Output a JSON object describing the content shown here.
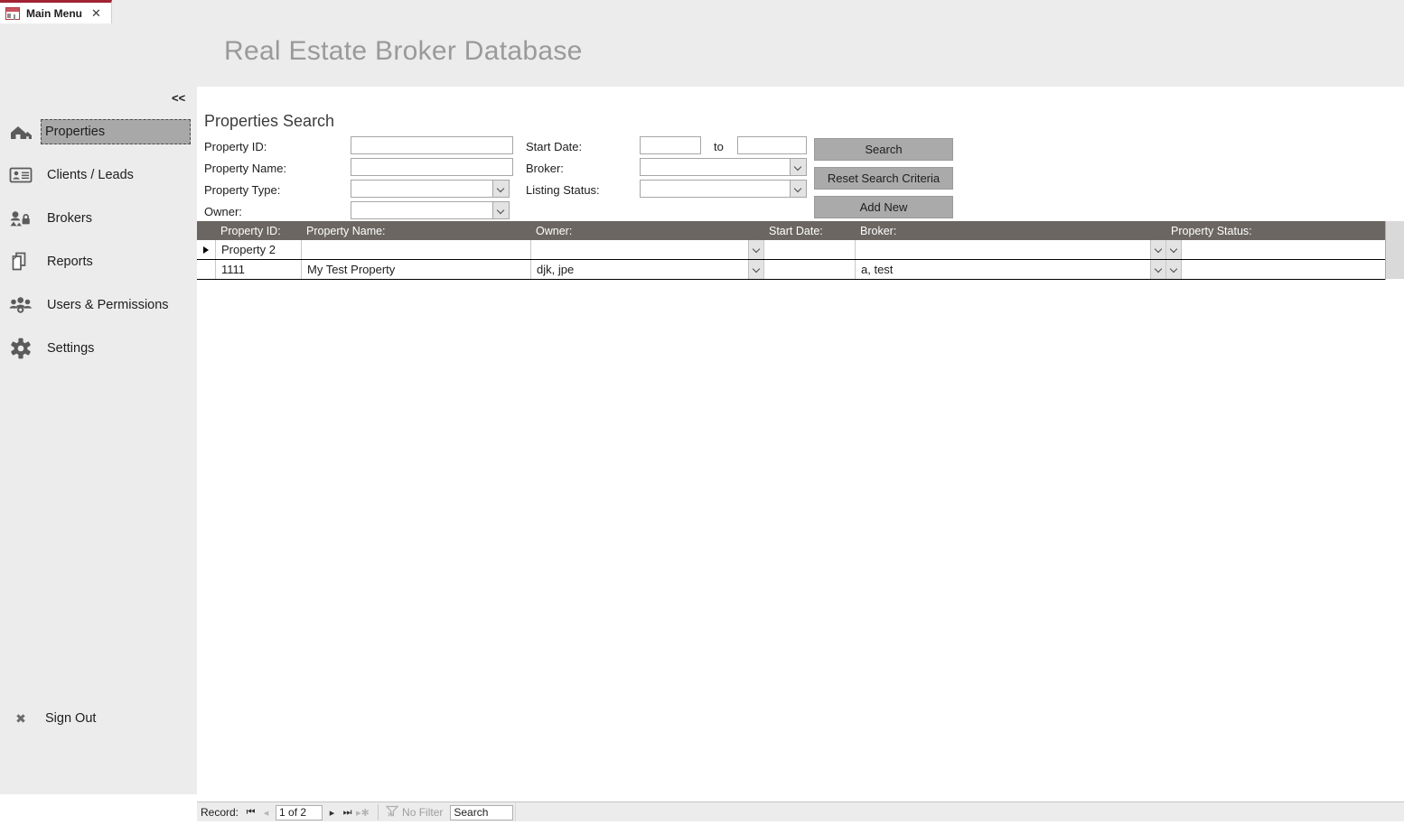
{
  "tab": {
    "label": "Main Menu",
    "icon": "access-form-icon",
    "close": "✕"
  },
  "header": {
    "title": "Real Estate Broker Database",
    "collapse": "<<"
  },
  "sidebar": {
    "items": [
      {
        "label": "Properties",
        "icon": "home-icon",
        "selected": true
      },
      {
        "label": "Clients / Leads",
        "icon": "id-card-icon",
        "selected": false
      },
      {
        "label": "Brokers",
        "icon": "broker-lock-icon",
        "selected": false
      },
      {
        "label": "Reports",
        "icon": "documents-icon",
        "selected": false
      },
      {
        "label": "Users & Permissions",
        "icon": "users-group-icon",
        "selected": false
      },
      {
        "label": "Settings",
        "icon": "gear-icon",
        "selected": false
      }
    ],
    "signout": {
      "label": "Sign Out",
      "icon": "close-x-icon"
    }
  },
  "main": {
    "panel_title": "Properties Search",
    "search_form": {
      "left_fields": [
        {
          "label": "Property ID:",
          "value": "",
          "control": "textbox"
        },
        {
          "label": "Property Name:",
          "value": "",
          "control": "textbox"
        },
        {
          "label": "Property Type:",
          "value": "",
          "control": "combobox"
        },
        {
          "label": "Owner:",
          "value": "",
          "control": "combobox"
        }
      ],
      "right_fields": [
        {
          "label": "Start Date:",
          "value": "",
          "value2": "",
          "between_label": "to",
          "control": "date-range"
        },
        {
          "label": "Broker:",
          "value": "",
          "control": "combobox"
        },
        {
          "label": "Listing Status:",
          "value": "",
          "control": "combobox"
        }
      ]
    },
    "buttons": {
      "search": "Search",
      "reset": "Reset Search Criteria",
      "add_new": "Add New"
    },
    "grid": {
      "columns": [
        "Property ID:",
        "Property Name:",
        "Owner:",
        "Start Date:",
        "Broker:",
        "Property Status:"
      ],
      "rows": [
        {
          "selected": true,
          "property_id": "Property 2",
          "property_name": "",
          "owner": "",
          "start_date": "",
          "broker": "",
          "property_status": ""
        },
        {
          "selected": false,
          "property_id": "1111",
          "property_name": "My Test Property",
          "owner": "djk, jpe",
          "start_date": "",
          "broker": "a, test",
          "property_status": ""
        }
      ]
    }
  },
  "navigator": {
    "record_label": "Record:",
    "first": "⏮",
    "previous": "◂",
    "position": "1 of 2",
    "next": "▸",
    "last": "⏭",
    "new_record": "▸✱",
    "filter_label": "No Filter",
    "filter_icon": "funnel-icon",
    "search_value": "Search"
  },
  "colors": {
    "accent": "#a02334",
    "chrome": "#ececec",
    "grid_header": "#6b6661",
    "button": "#aaaaaa",
    "title_text": "#9a9a9a"
  }
}
